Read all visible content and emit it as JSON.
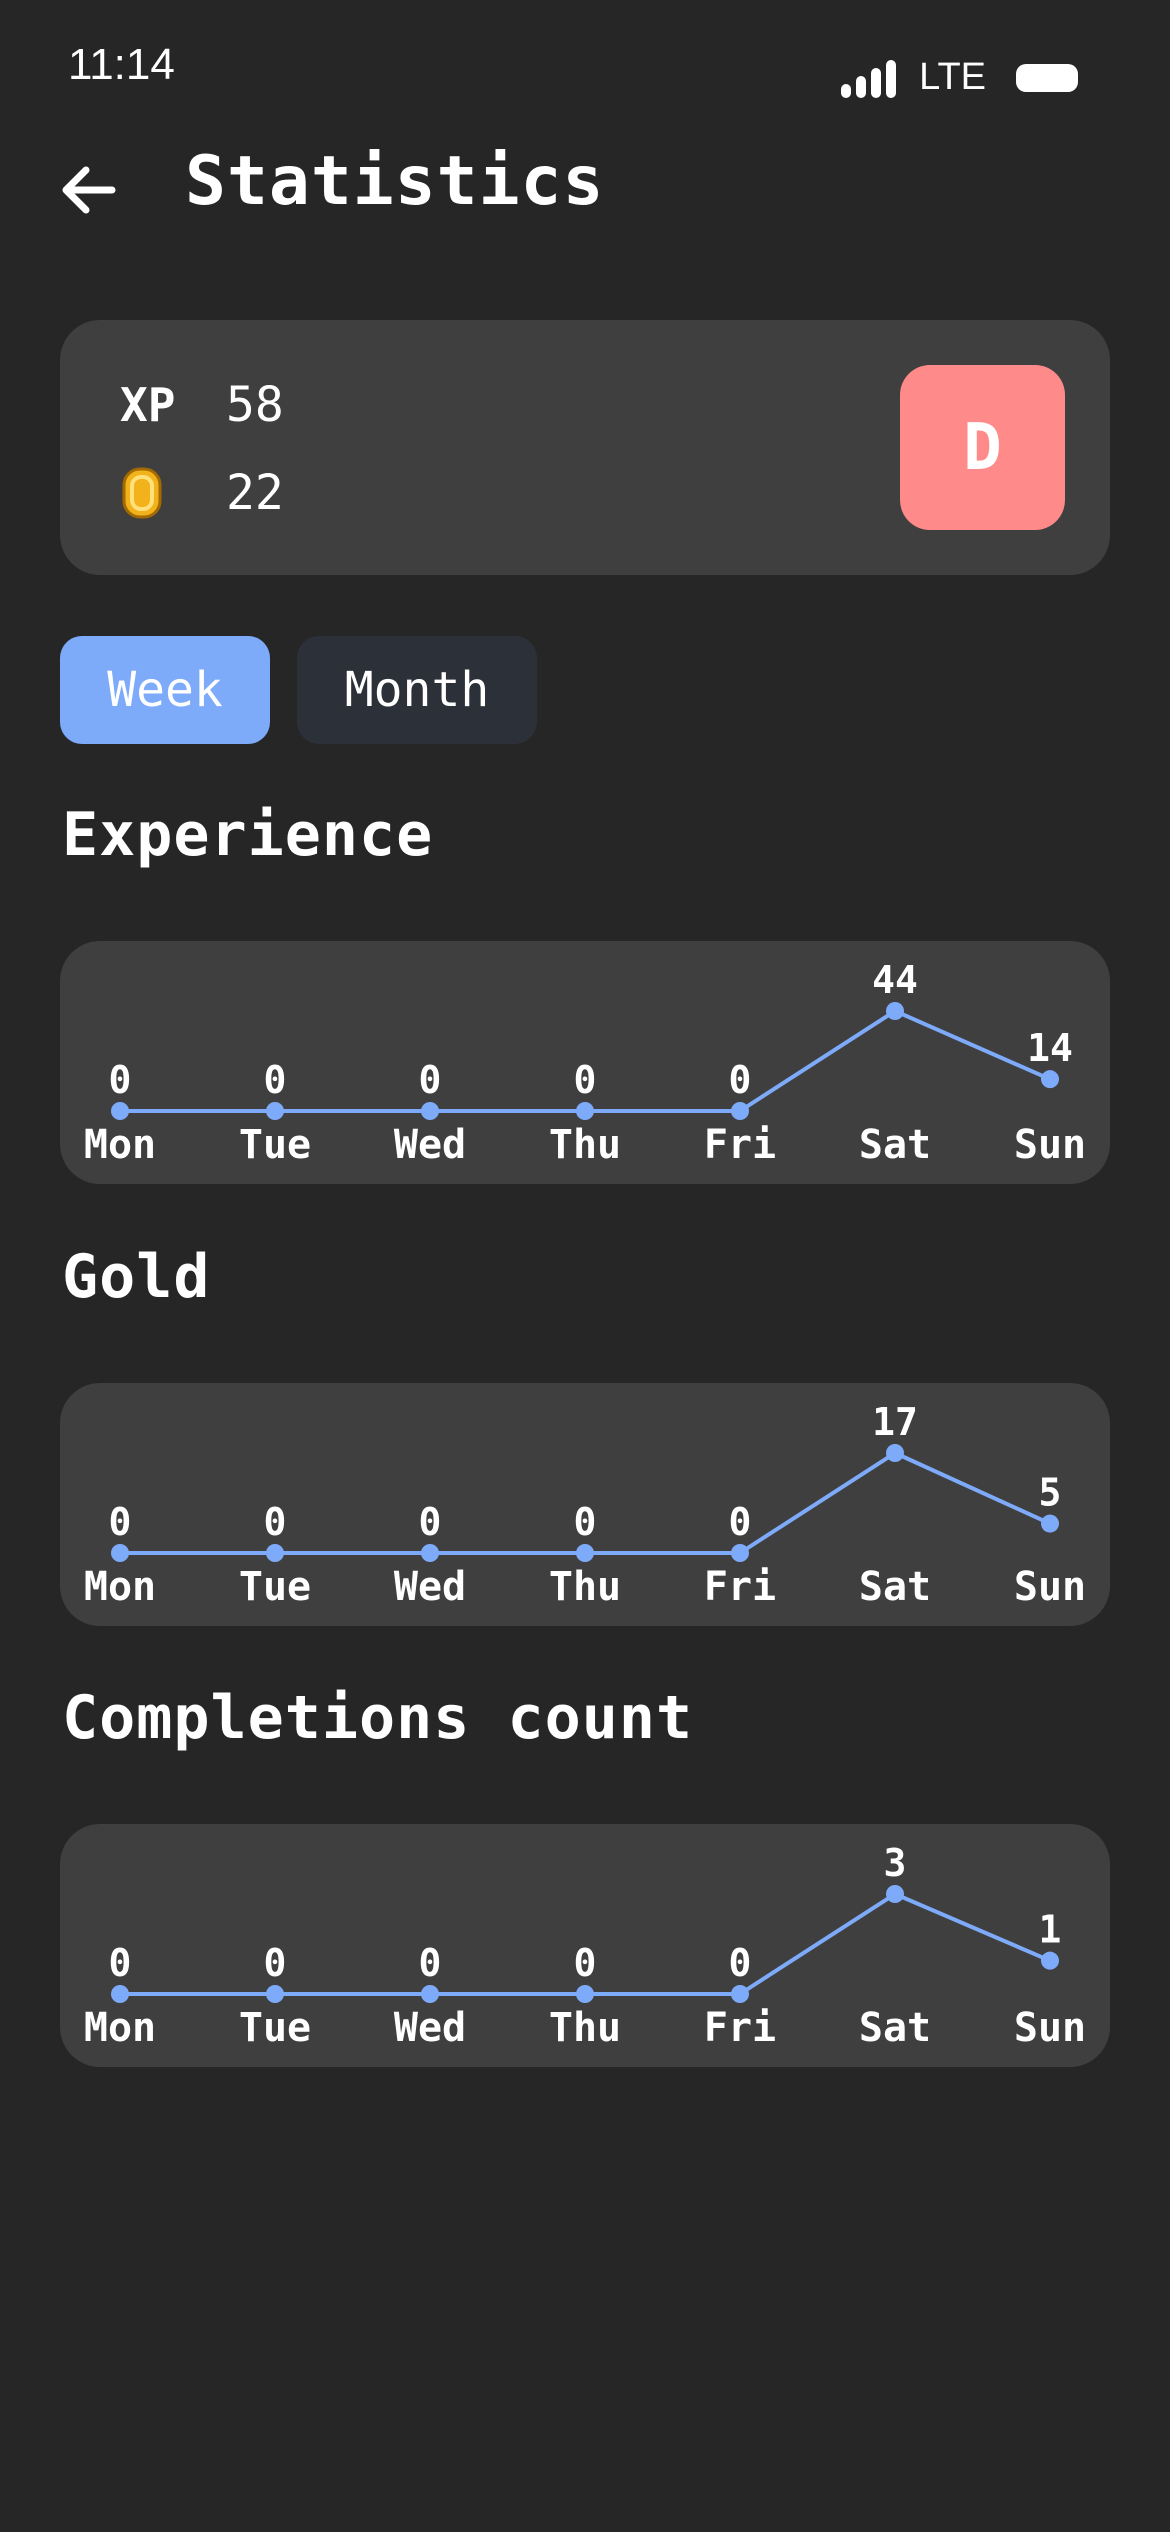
{
  "status_bar": {
    "time": "11:14",
    "network": "LTE"
  },
  "header": {
    "title": "Statistics",
    "back_icon": "arrow-left-icon"
  },
  "summary": {
    "xp_label": "XP",
    "xp_value": "58",
    "gold_icon": "coin-icon",
    "gold_value": "22",
    "rank": "D",
    "rank_color": "#ff8a8a"
  },
  "tabs": [
    {
      "label": "Week",
      "active": true
    },
    {
      "label": "Month",
      "active": false
    }
  ],
  "colors": {
    "accent": "#7eaafa",
    "card": "#3f3f3f",
    "background": "#262626"
  },
  "sections": {
    "experience_title": "Experience",
    "gold_title": "Gold",
    "completions_title": "Completions count"
  },
  "chart_data": [
    {
      "type": "line",
      "title": "Experience",
      "categories": [
        "Mon",
        "Tue",
        "Wed",
        "Thu",
        "Fri",
        "Sat",
        "Sun"
      ],
      "values": [
        0,
        0,
        0,
        0,
        0,
        44,
        14
      ]
    },
    {
      "type": "line",
      "title": "Gold",
      "categories": [
        "Mon",
        "Tue",
        "Wed",
        "Thu",
        "Fri",
        "Sat",
        "Sun"
      ],
      "values": [
        0,
        0,
        0,
        0,
        0,
        17,
        5
      ]
    },
    {
      "type": "line",
      "title": "Completions count",
      "categories": [
        "Mon",
        "Tue",
        "Wed",
        "Thu",
        "Fri",
        "Sat",
        "Sun"
      ],
      "values": [
        0,
        0,
        0,
        0,
        0,
        3,
        1
      ]
    }
  ]
}
